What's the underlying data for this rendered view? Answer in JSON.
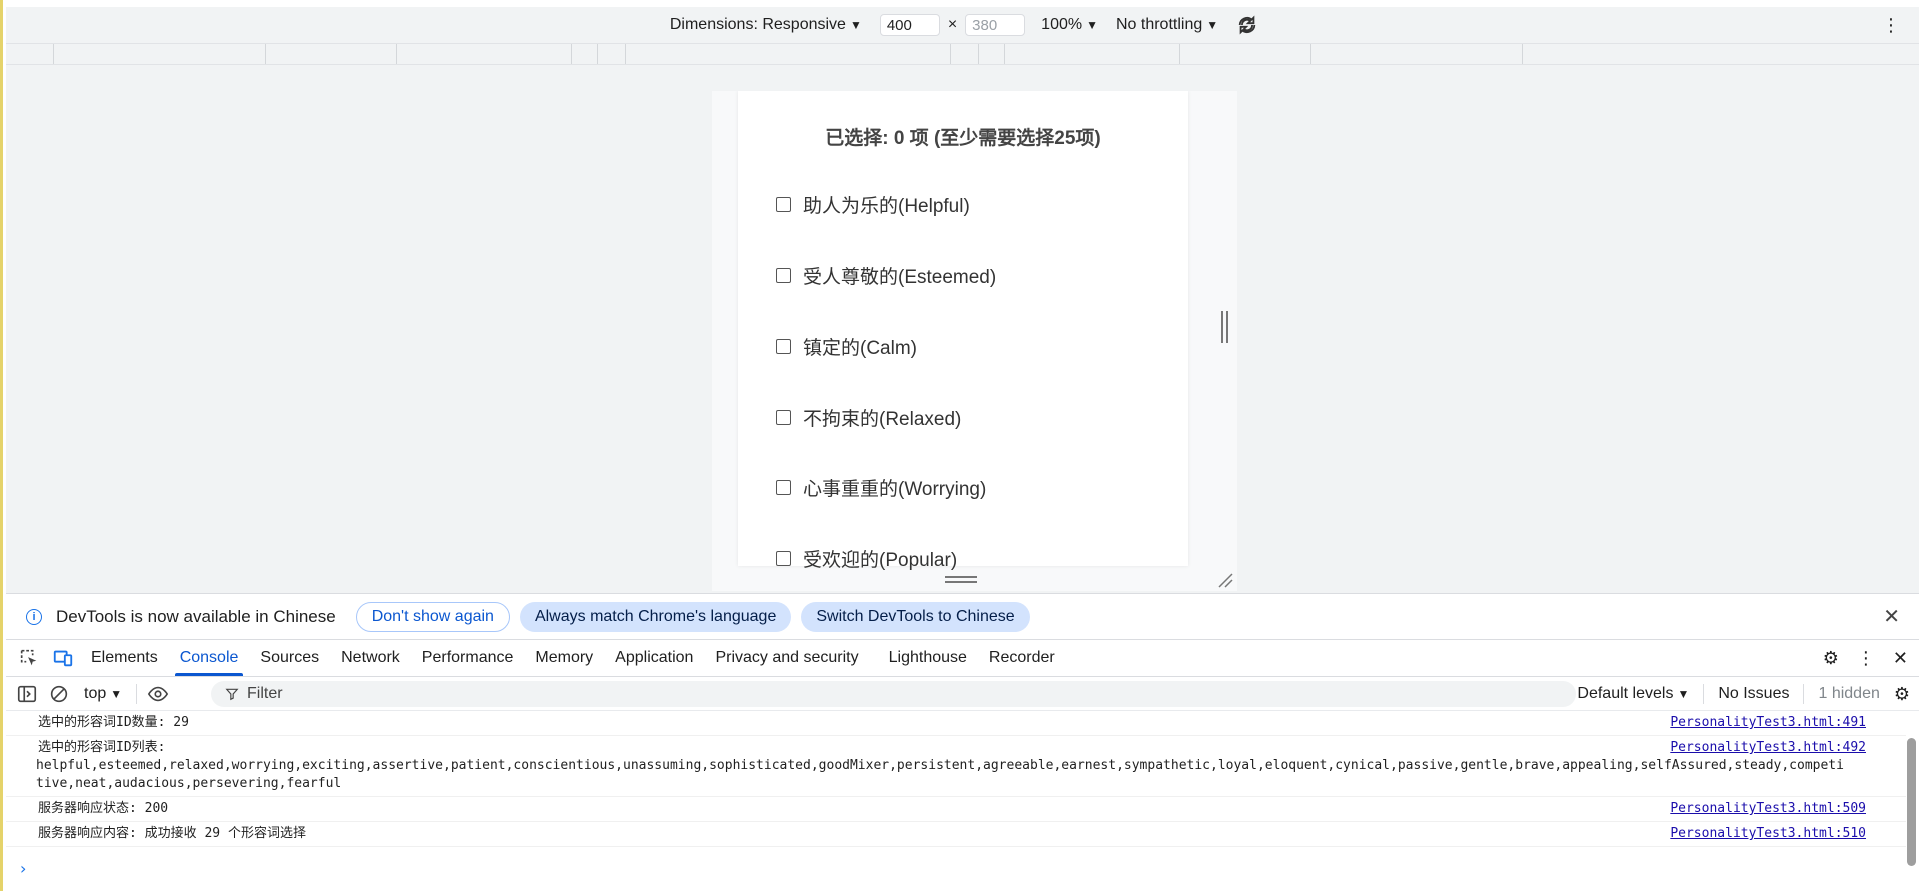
{
  "device_toolbar": {
    "dimensions_label": "Dimensions: Responsive",
    "width_value": "400",
    "height_placeholder": "380",
    "zoom": "100%",
    "throttling": "No throttling"
  },
  "page": {
    "summary": "已选择: 0 项 (至少需要选择25项)",
    "items": [
      {
        "label": "助人为乐的(Helpful)"
      },
      {
        "label": "受人尊敬的(Esteemed)"
      },
      {
        "label": "镇定的(Calm)"
      },
      {
        "label": "不拘束的(Relaxed)"
      },
      {
        "label": "心事重重的(Worrying)"
      },
      {
        "label": "受欢迎的(Popular)"
      }
    ]
  },
  "infobar": {
    "message": "DevTools is now available in Chinese",
    "btn_dont_show": "Don't show again",
    "btn_match": "Always match Chrome's language",
    "btn_switch": "Switch DevTools to Chinese"
  },
  "tabs": [
    "Elements",
    "Console",
    "Sources",
    "Network",
    "Performance",
    "Memory",
    "Application",
    "Privacy and security",
    "Lighthouse",
    "Recorder"
  ],
  "console_toolbar": {
    "context": "top",
    "filter_placeholder": "Filter",
    "levels": "Default levels",
    "issues": "No Issues",
    "hidden": "1 hidden"
  },
  "console": {
    "messages": [
      {
        "text": "选中的形容词ID数量: 29",
        "body": "",
        "source": "PersonalityTest3.html:491"
      },
      {
        "text": "选中的形容词ID列表:",
        "body": "helpful,esteemed,relaxed,worrying,exciting,assertive,patient,conscientious,unassuming,sophisticated,goodMixer,persistent,agreeable,earnest,sympathetic,loyal,eloquent,cynical,passive,gentle,brave,appealing,selfAssured,steady,competitive,neat,audacious,persevering,fearful",
        "source": "PersonalityTest3.html:492"
      },
      {
        "text": "服务器响应状态: 200",
        "body": "",
        "source": "PersonalityTest3.html:509"
      },
      {
        "text": "服务器响应内容: 成功接收 29 个形容词选择",
        "body": "",
        "source": "PersonalityTest3.html:510"
      }
    ]
  }
}
